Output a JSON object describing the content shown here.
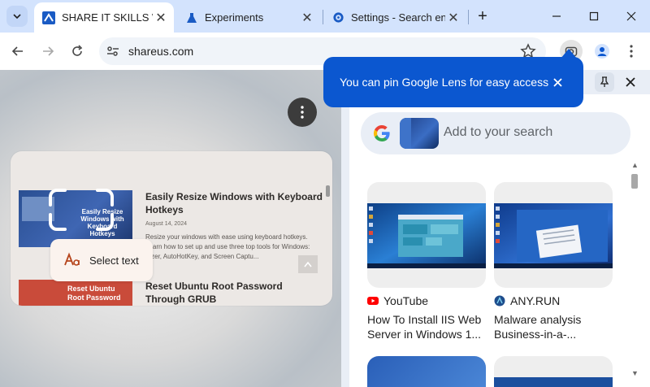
{
  "tabs": [
    {
      "title": "SHARE IT SKILLS WIT",
      "active": true,
      "favicon": "shareus-logo-icon"
    },
    {
      "title": "Experiments",
      "active": false,
      "favicon": "flask-icon"
    },
    {
      "title": "Settings - Search en",
      "active": false,
      "favicon": "gear-icon"
    }
  ],
  "toolbar": {
    "url": "shareus.com"
  },
  "page": {
    "articles": [
      {
        "title": "Easily Resize Windows with Keyboard Hotkeys",
        "date": "August 14, 2024",
        "excerpt": "Resize your windows with ease using keyboard hotkeys. Learn how to set up and use three top tools for Windows: Sizer, AutoHotKey, and Screen Captu...",
        "thumb_text": "Easily Resize Windows with Keyboard Hotkeys"
      },
      {
        "title": "Reset Ubuntu Root Password Through GRUB",
        "thumb_text": "Reset Ubuntu Root Password"
      }
    ],
    "select_text_label": "Select text"
  },
  "lens": {
    "bubble_text": "You can pin Google Lens for easy access",
    "search_placeholder": "Add to your search",
    "results": [
      {
        "source": "YouTube",
        "source_icon": "youtube-icon",
        "title": "How To Install IIS Web Server in Windows 1..."
      },
      {
        "source": "ANY.RUN",
        "source_icon": "anyrun-icon",
        "title": "Malware analysis Business-in-a-..."
      }
    ]
  },
  "colors": {
    "accent": "#0b57d0",
    "tabstrip": "#d3e3fd"
  }
}
